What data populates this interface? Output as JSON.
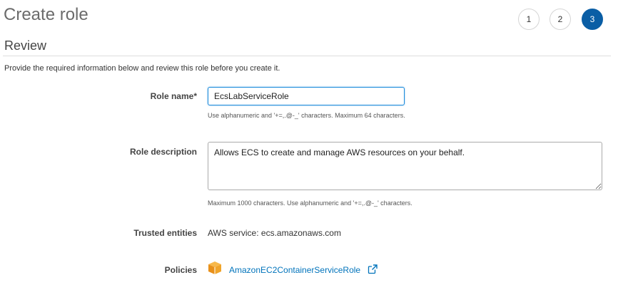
{
  "header": {
    "title": "Create role",
    "steps": [
      "1",
      "2",
      "3"
    ],
    "active_step": "3"
  },
  "review": {
    "title": "Review",
    "intro": "Provide the required information below and review this role before you create it."
  },
  "form": {
    "role_name": {
      "label": "Role name*",
      "value": "EcsLabServiceRole",
      "hint": "Use alphanumeric and '+=,.@-_' characters. Maximum 64 characters."
    },
    "role_description": {
      "label": "Role description",
      "value": "Allows ECS to create and manage AWS resources on your behalf.",
      "hint": "Maximum 1000 characters. Use alphanumeric and '+=,.@-_' characters."
    },
    "trusted_entities": {
      "label": "Trusted entities",
      "value": "AWS service: ecs.amazonaws.com"
    },
    "policies": {
      "label": "Policies",
      "items": [
        {
          "name": "AmazonEC2ContainerServiceRole",
          "icon": "aws-policy-cube-icon"
        }
      ]
    }
  },
  "colors": {
    "active_step": "#0a5ea5",
    "link": "#0073bb",
    "focus_border": "#1b8adb",
    "policy_icon": "#f0a42a"
  }
}
